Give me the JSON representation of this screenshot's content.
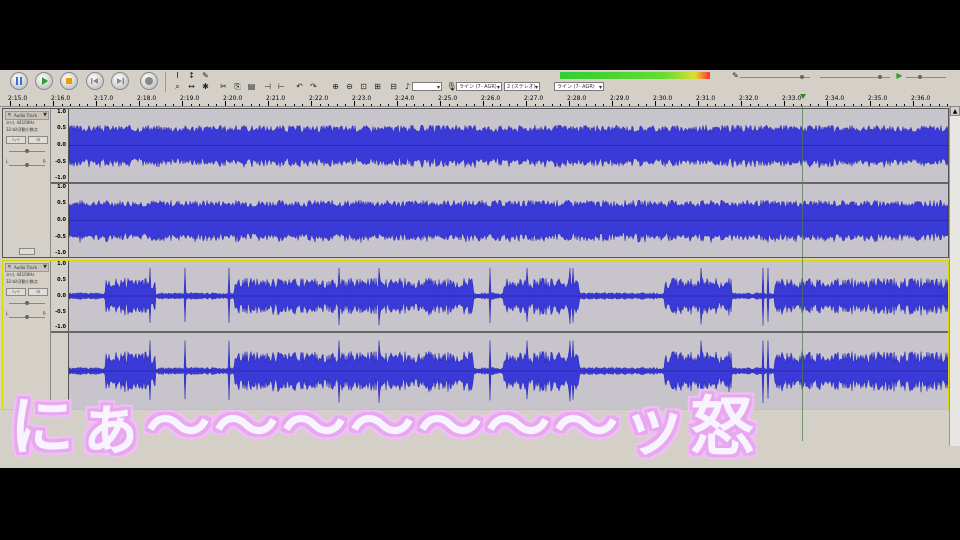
{
  "toolbar": {
    "transport": [
      {
        "name": "pause",
        "color": "#3a6fd8"
      },
      {
        "name": "play",
        "color": "#2aa02a"
      },
      {
        "name": "stop",
        "color": "#e8a000"
      },
      {
        "name": "skip-start",
        "color": "#7a7a7a"
      },
      {
        "name": "skip-end",
        "color": "#7a7a7a"
      },
      {
        "name": "record",
        "color": "#7a7a7a"
      }
    ],
    "selects": [
      "ライン (7- AGR)",
      "2 (ステレオ)",
      "ライン (7- AGR)"
    ],
    "meter_colors": [
      "#33cc33",
      "#dddd33",
      "#ff3333"
    ]
  },
  "ruler": {
    "labels": [
      "2:15.0",
      "2:16.0",
      "2:17.0",
      "2:18.0",
      "2:19.0",
      "2:20.0",
      "2:21.0",
      "2:22.0",
      "2:23.0",
      "2:24.0",
      "2:25.0",
      "2:26.0",
      "2:27.0",
      "2:28.0",
      "2:29.0",
      "2:30.0",
      "2:31.0",
      "2:32.0",
      "2:33.0",
      "2:34.0",
      "2:35.0",
      "2:36.0"
    ]
  },
  "tracks": [
    {
      "title": "Audio Track",
      "info1": "ｽﾃﾚｵ, 44100Hz",
      "info2": "32-bit浮動小数点",
      "mute": "ﾐｭｰﾄ",
      "solo": "ｿﾛ",
      "pan_l": "L",
      "pan_r": "R",
      "y_labels": [
        "1.0",
        "0.5",
        "0.0",
        "-0.5",
        "-1.0"
      ],
      "selected": false,
      "wave_type": "dense"
    },
    {
      "title": "Audio Track",
      "info1": "ｽﾃﾚｵ, 44100Hz",
      "info2": "32-bit浮動小数点",
      "mute": "ﾐｭｰﾄ",
      "solo": "ｿﾛ",
      "pan_l": "L",
      "pan_r": "R",
      "y_labels": [
        "1.0",
        "0.5",
        "0.0",
        "-0.5",
        "-1.0"
      ],
      "selected": true,
      "wave_type": "sparse"
    }
  ],
  "colors": {
    "wave_fill": "#3a3ad8",
    "wave_peak": "#2222b0",
    "caption_outline": "#e8a8f0"
  },
  "caption": "にぁ〜〜〜〜〜〜〜ッ怒"
}
